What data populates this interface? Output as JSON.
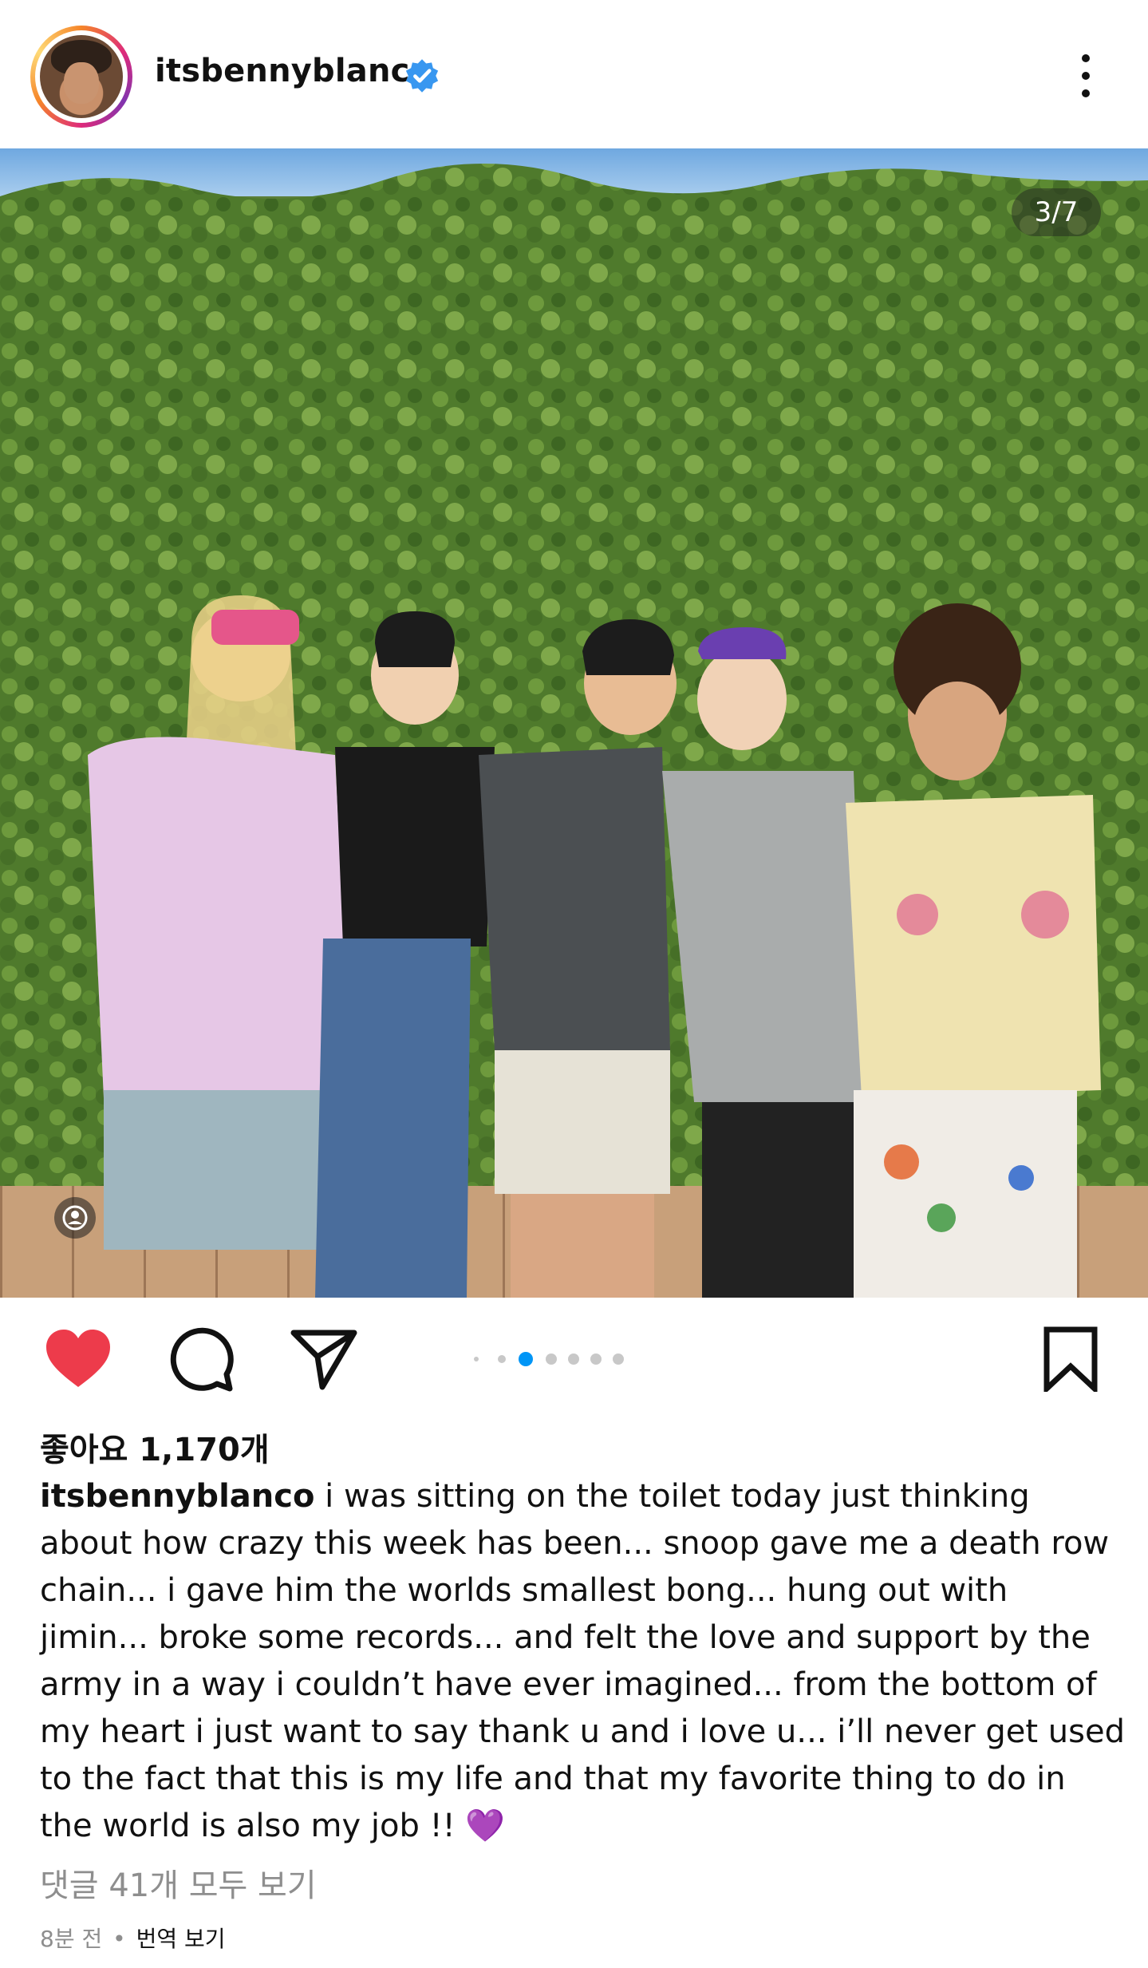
{
  "header": {
    "username": "itsbennyblanco",
    "verified": true
  },
  "post": {
    "image_counter": "3/7",
    "current_image": 3,
    "total_images": 7,
    "liked": true,
    "likes_text": "좋아요 1,170개",
    "caption_user": "itsbennyblanco",
    "caption_text": " i was sitting on the toilet today just thinking about how crazy this week has been... snoop gave me a death row chain... i gave him the worlds smallest bong... hung out with jimin... broke some records... and felt the love and support by the army in a way i couldn’t have ever imagined... from the bottom of my heart i just want to say thank u and i love u... i’ll never get used to the fact that this is my life and that my favorite thing to do in the world is also my job !! 💜",
    "comments_link": "댓글 41개 모두 보기",
    "timestamp": "8분 전",
    "separator": "•",
    "translate_label": "번역 보기"
  },
  "colors": {
    "like_red": "#ed3b4b",
    "verified_blue": "#3897f0",
    "active_dot": "#0095f6"
  },
  "icons": [
    "more-vertical-icon",
    "verified-badge-icon",
    "heart-icon",
    "comment-icon",
    "share-icon",
    "bookmark-icon",
    "user-tag-icon"
  ]
}
